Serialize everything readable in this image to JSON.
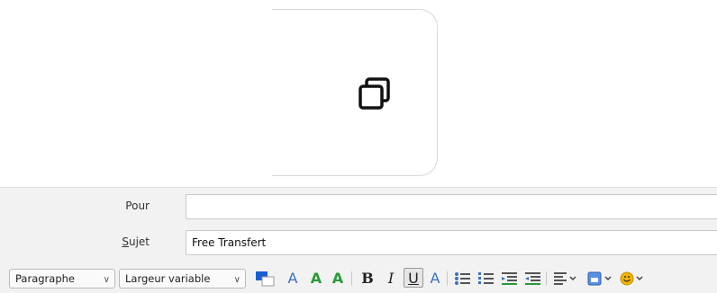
{
  "compose": {
    "to_label": "Pour",
    "to_value": "",
    "subject_label_first": "S",
    "subject_label_rest": "ujet",
    "subject_value": "Free Transfert"
  },
  "toolbar": {
    "paragraph_select": "Paragraphe",
    "font_select": "Largeur variable"
  },
  "icons": {
    "copy": "copy-icon",
    "text_color": "text-color-icon",
    "font_smaller": "font-smaller-icon",
    "font_larger": "font-larger-icon",
    "bold": "bold-icon",
    "italic": "italic-icon",
    "underline": "underline-icon",
    "text_style": "text-style-icon",
    "bulleted_list": "bulleted-list-icon",
    "numbered_list": "numbered-list-icon",
    "outdent": "outdent-icon",
    "indent": "indent-icon",
    "align": "align-icon",
    "insert": "insert-icon",
    "emoji": "emoji-icon"
  },
  "colors": {
    "accent": "#3a6fc5",
    "text_color_swatch": "#1a5fd0",
    "emoji": "#f0b400"
  }
}
